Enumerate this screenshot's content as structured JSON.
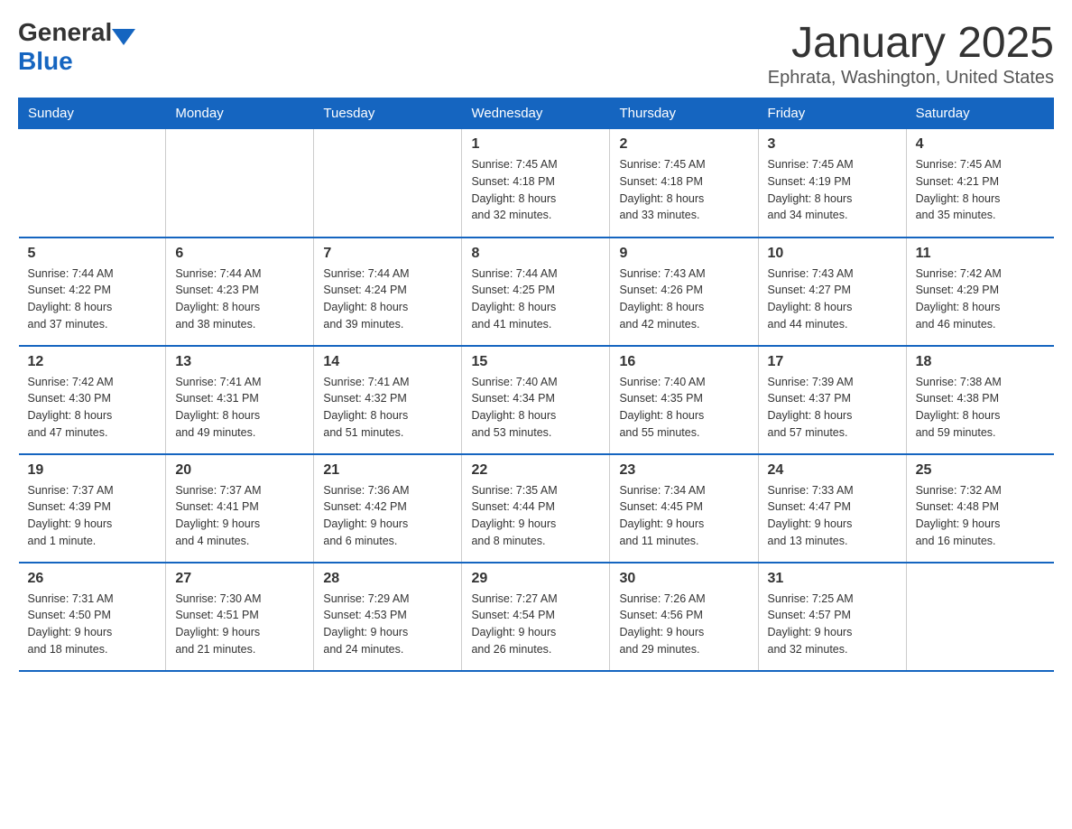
{
  "header": {
    "logo_general": "General",
    "logo_blue": "Blue",
    "title": "January 2025",
    "subtitle": "Ephrata, Washington, United States"
  },
  "days_of_week": [
    "Sunday",
    "Monday",
    "Tuesday",
    "Wednesday",
    "Thursday",
    "Friday",
    "Saturday"
  ],
  "weeks": [
    [
      {
        "day": "",
        "info": ""
      },
      {
        "day": "",
        "info": ""
      },
      {
        "day": "",
        "info": ""
      },
      {
        "day": "1",
        "info": "Sunrise: 7:45 AM\nSunset: 4:18 PM\nDaylight: 8 hours\nand 32 minutes."
      },
      {
        "day": "2",
        "info": "Sunrise: 7:45 AM\nSunset: 4:18 PM\nDaylight: 8 hours\nand 33 minutes."
      },
      {
        "day": "3",
        "info": "Sunrise: 7:45 AM\nSunset: 4:19 PM\nDaylight: 8 hours\nand 34 minutes."
      },
      {
        "day": "4",
        "info": "Sunrise: 7:45 AM\nSunset: 4:21 PM\nDaylight: 8 hours\nand 35 minutes."
      }
    ],
    [
      {
        "day": "5",
        "info": "Sunrise: 7:44 AM\nSunset: 4:22 PM\nDaylight: 8 hours\nand 37 minutes."
      },
      {
        "day": "6",
        "info": "Sunrise: 7:44 AM\nSunset: 4:23 PM\nDaylight: 8 hours\nand 38 minutes."
      },
      {
        "day": "7",
        "info": "Sunrise: 7:44 AM\nSunset: 4:24 PM\nDaylight: 8 hours\nand 39 minutes."
      },
      {
        "day": "8",
        "info": "Sunrise: 7:44 AM\nSunset: 4:25 PM\nDaylight: 8 hours\nand 41 minutes."
      },
      {
        "day": "9",
        "info": "Sunrise: 7:43 AM\nSunset: 4:26 PM\nDaylight: 8 hours\nand 42 minutes."
      },
      {
        "day": "10",
        "info": "Sunrise: 7:43 AM\nSunset: 4:27 PM\nDaylight: 8 hours\nand 44 minutes."
      },
      {
        "day": "11",
        "info": "Sunrise: 7:42 AM\nSunset: 4:29 PM\nDaylight: 8 hours\nand 46 minutes."
      }
    ],
    [
      {
        "day": "12",
        "info": "Sunrise: 7:42 AM\nSunset: 4:30 PM\nDaylight: 8 hours\nand 47 minutes."
      },
      {
        "day": "13",
        "info": "Sunrise: 7:41 AM\nSunset: 4:31 PM\nDaylight: 8 hours\nand 49 minutes."
      },
      {
        "day": "14",
        "info": "Sunrise: 7:41 AM\nSunset: 4:32 PM\nDaylight: 8 hours\nand 51 minutes."
      },
      {
        "day": "15",
        "info": "Sunrise: 7:40 AM\nSunset: 4:34 PM\nDaylight: 8 hours\nand 53 minutes."
      },
      {
        "day": "16",
        "info": "Sunrise: 7:40 AM\nSunset: 4:35 PM\nDaylight: 8 hours\nand 55 minutes."
      },
      {
        "day": "17",
        "info": "Sunrise: 7:39 AM\nSunset: 4:37 PM\nDaylight: 8 hours\nand 57 minutes."
      },
      {
        "day": "18",
        "info": "Sunrise: 7:38 AM\nSunset: 4:38 PM\nDaylight: 8 hours\nand 59 minutes."
      }
    ],
    [
      {
        "day": "19",
        "info": "Sunrise: 7:37 AM\nSunset: 4:39 PM\nDaylight: 9 hours\nand 1 minute."
      },
      {
        "day": "20",
        "info": "Sunrise: 7:37 AM\nSunset: 4:41 PM\nDaylight: 9 hours\nand 4 minutes."
      },
      {
        "day": "21",
        "info": "Sunrise: 7:36 AM\nSunset: 4:42 PM\nDaylight: 9 hours\nand 6 minutes."
      },
      {
        "day": "22",
        "info": "Sunrise: 7:35 AM\nSunset: 4:44 PM\nDaylight: 9 hours\nand 8 minutes."
      },
      {
        "day": "23",
        "info": "Sunrise: 7:34 AM\nSunset: 4:45 PM\nDaylight: 9 hours\nand 11 minutes."
      },
      {
        "day": "24",
        "info": "Sunrise: 7:33 AM\nSunset: 4:47 PM\nDaylight: 9 hours\nand 13 minutes."
      },
      {
        "day": "25",
        "info": "Sunrise: 7:32 AM\nSunset: 4:48 PM\nDaylight: 9 hours\nand 16 minutes."
      }
    ],
    [
      {
        "day": "26",
        "info": "Sunrise: 7:31 AM\nSunset: 4:50 PM\nDaylight: 9 hours\nand 18 minutes."
      },
      {
        "day": "27",
        "info": "Sunrise: 7:30 AM\nSunset: 4:51 PM\nDaylight: 9 hours\nand 21 minutes."
      },
      {
        "day": "28",
        "info": "Sunrise: 7:29 AM\nSunset: 4:53 PM\nDaylight: 9 hours\nand 24 minutes."
      },
      {
        "day": "29",
        "info": "Sunrise: 7:27 AM\nSunset: 4:54 PM\nDaylight: 9 hours\nand 26 minutes."
      },
      {
        "day": "30",
        "info": "Sunrise: 7:26 AM\nSunset: 4:56 PM\nDaylight: 9 hours\nand 29 minutes."
      },
      {
        "day": "31",
        "info": "Sunrise: 7:25 AM\nSunset: 4:57 PM\nDaylight: 9 hours\nand 32 minutes."
      },
      {
        "day": "",
        "info": ""
      }
    ]
  ]
}
